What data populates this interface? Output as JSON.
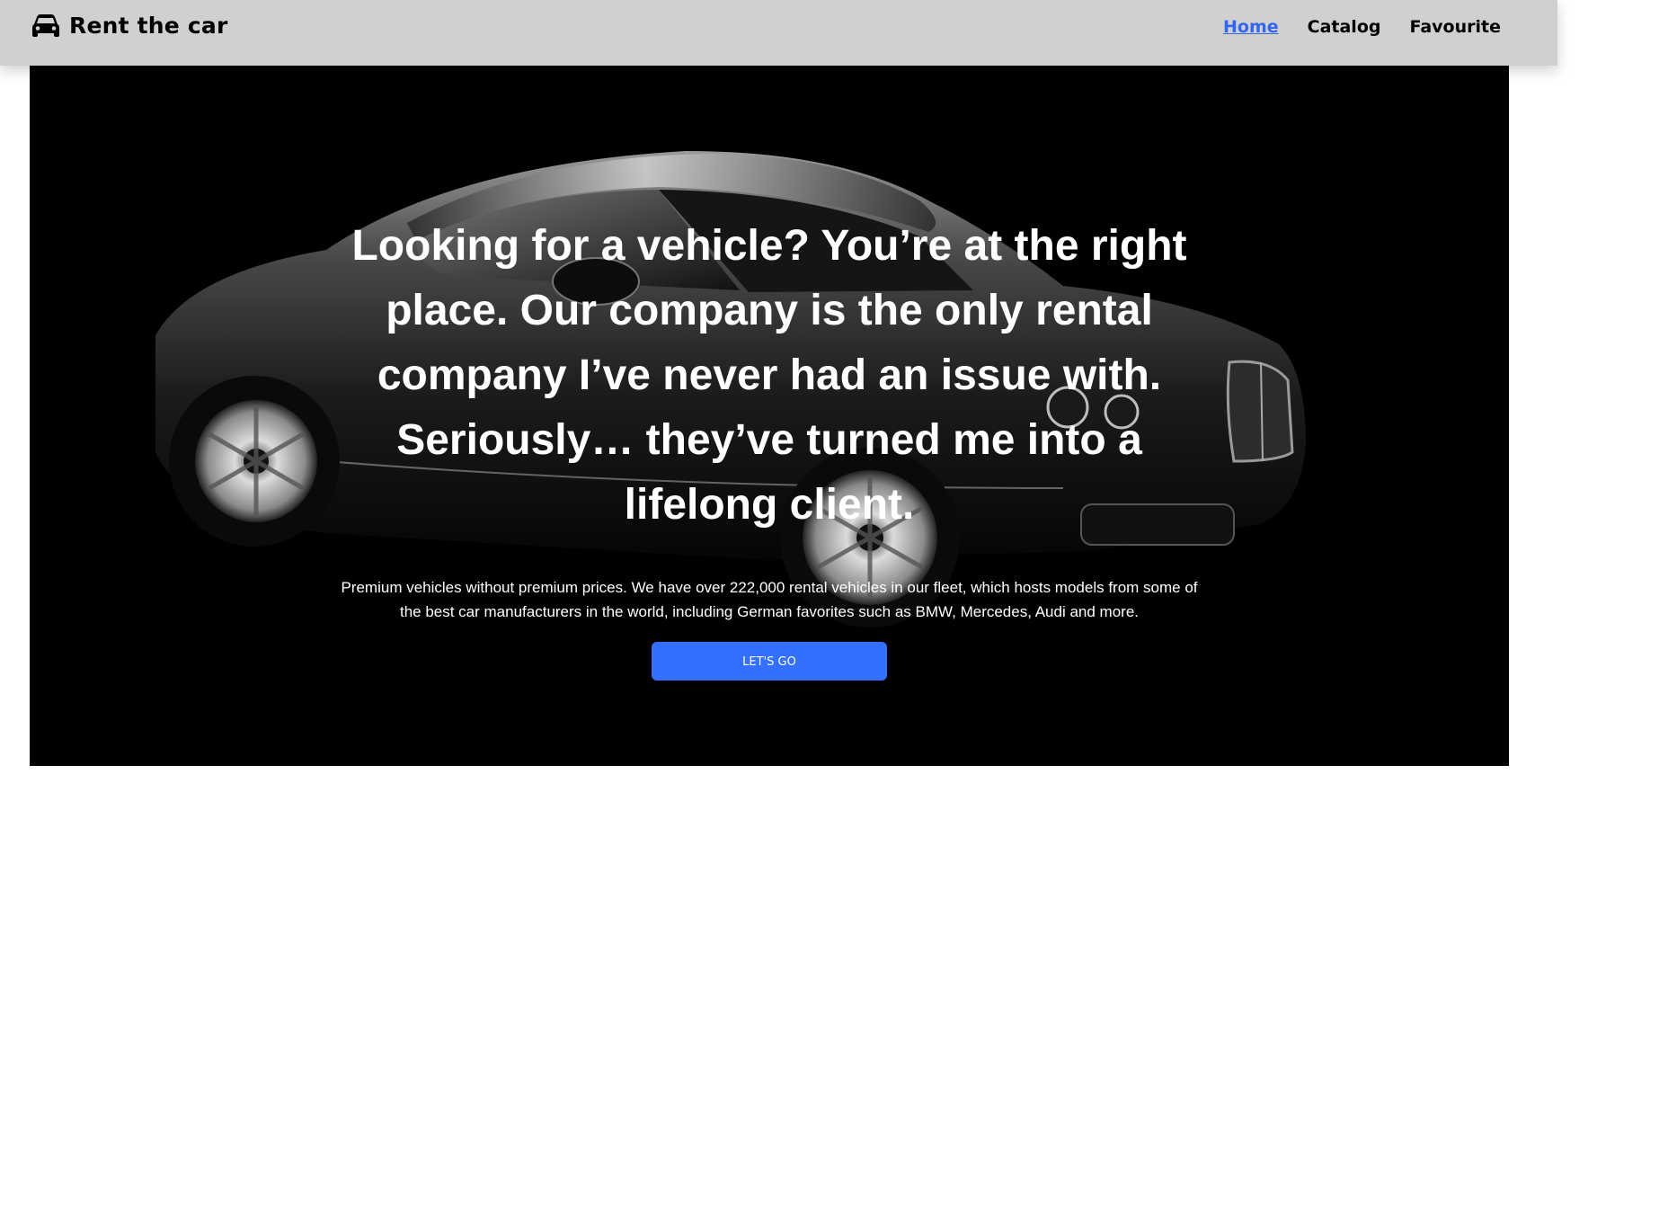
{
  "header": {
    "logo_icon": "car-icon",
    "brand": "Rent the car",
    "nav": [
      {
        "label": "Home",
        "active": true
      },
      {
        "label": "Catalog",
        "active": false
      },
      {
        "label": "Favourite",
        "active": false
      }
    ]
  },
  "hero": {
    "heading": "Looking for a vehicle? You’re at the right place. Our company is the only rental company I’ve never had an issue with. Seriously… they’ve turned me into a lifelong client.",
    "text": "Premium vehicles without premium prices. We have over 222,000 rental vehicles in our fleet, which hosts models from some of the best car manufacturers in the world, including German favorites such as BMW, Mercedes, Audi and more.",
    "button": "LET'S GO",
    "background": "black-luxury-car-photo"
  },
  "colors": {
    "header_bg": "#d0d0d0",
    "accent": "#3370ff",
    "active_link": "#3366ee",
    "hero_bg": "#000000"
  }
}
